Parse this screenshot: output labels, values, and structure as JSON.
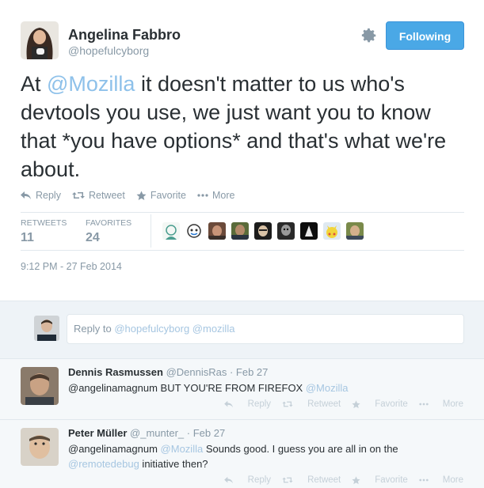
{
  "tweet": {
    "author_name": "Angelina Fabbro",
    "author_handle": "@hopefulcyborg",
    "follow_label": "Following",
    "text_before": "At ",
    "mention": "@Mozilla",
    "text_after": " it doesn't matter to us who's devtools you use, we just want you to know that *you have options* and that's what we're about.",
    "actions": {
      "reply": "Reply",
      "retweet": "Retweet",
      "favorite": "Favorite",
      "more": "More"
    },
    "stats": {
      "retweets_label": "RETWEETS",
      "retweets_value": "11",
      "favorites_label": "FAVORITES",
      "favorites_value": "24"
    },
    "timestamp": "9:12 PM - 27 Feb 2014"
  },
  "reply_box": {
    "prefix": "Reply to ",
    "mentions": "@hopefulcyborg @mozilla"
  },
  "replies": [
    {
      "name": "Dennis Rasmussen",
      "handle": "@DennisRas · Feb 27",
      "text": "@angelinamagnum BUT YOU'RE FROM FIREFOX ",
      "link": "@Mozilla",
      "text_after": ""
    },
    {
      "name": "Peter Müller",
      "handle": "@_munter_ · Feb 27",
      "text": "@angelinamagnum ",
      "link": "@Mozilla",
      "text_after": " Sounds good. I guess you are all in on the ",
      "link2": "@remotedebug",
      "text_after2": " initiative then?"
    }
  ],
  "reply_actions": {
    "reply": "Reply",
    "retweet": "Retweet",
    "favorite": "Favorite",
    "more": "More"
  },
  "colors": {
    "accent": "#4aa8e6",
    "mention": "#8ec1ea",
    "muted": "#8899a6"
  }
}
